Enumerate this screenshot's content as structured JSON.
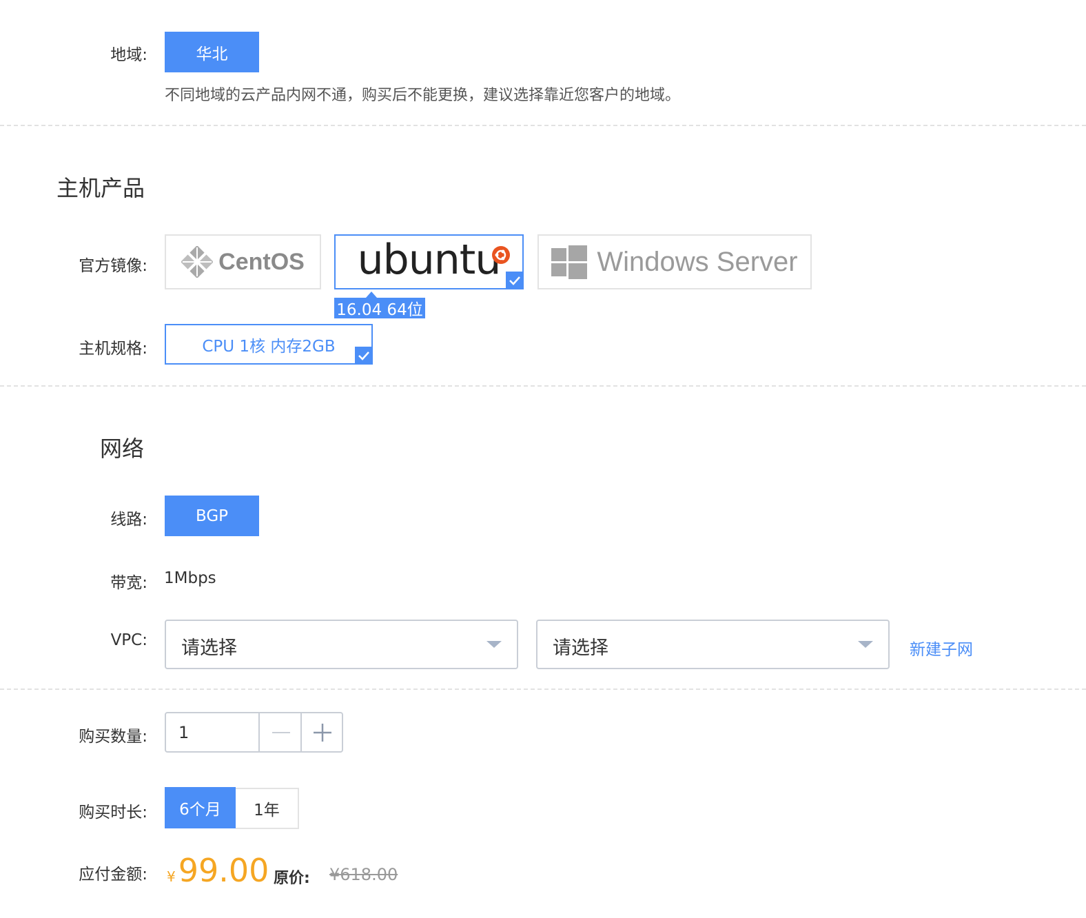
{
  "region": {
    "label": "地域:",
    "value": "华北",
    "hint": "不同地域的云产品内网不通，购买后不能更换，建议选择靠近您客户的地域。"
  },
  "host": {
    "title": "主机产品",
    "image_label": "官方镜像:",
    "images": [
      {
        "name": "CentOS",
        "icon": "centos-logo"
      },
      {
        "name": "ubuntu",
        "icon": "ubuntu-logo",
        "selected": true
      },
      {
        "name": "Windows Server",
        "icon": "windows-logo"
      }
    ],
    "image_version": "16.04 64位",
    "spec_label": "主机规格:",
    "spec_value": "CPU 1核 内存2GB"
  },
  "network": {
    "title": "网络",
    "line_label": "线路:",
    "line_value": "BGP",
    "bandwidth_label": "带宽:",
    "bandwidth_value": "1Mbps",
    "vpc_label": "VPC:",
    "vpc_placeholder_1": "请选择",
    "vpc_placeholder_2": "请选择",
    "new_subnet": "新建子网"
  },
  "purchase": {
    "quantity_label": "购买数量:",
    "quantity_value": "1",
    "duration_label": "购买时长:",
    "duration_options": [
      "6个月",
      "1年"
    ],
    "duration_selected": "6个月",
    "amount_label": "应付金额:",
    "currency_symbol": "¥",
    "price": "99.00",
    "original_label": "原价:",
    "original_price": "¥618.00",
    "accent_color": "#f5a623",
    "primary_color": "#4b8ef7"
  }
}
